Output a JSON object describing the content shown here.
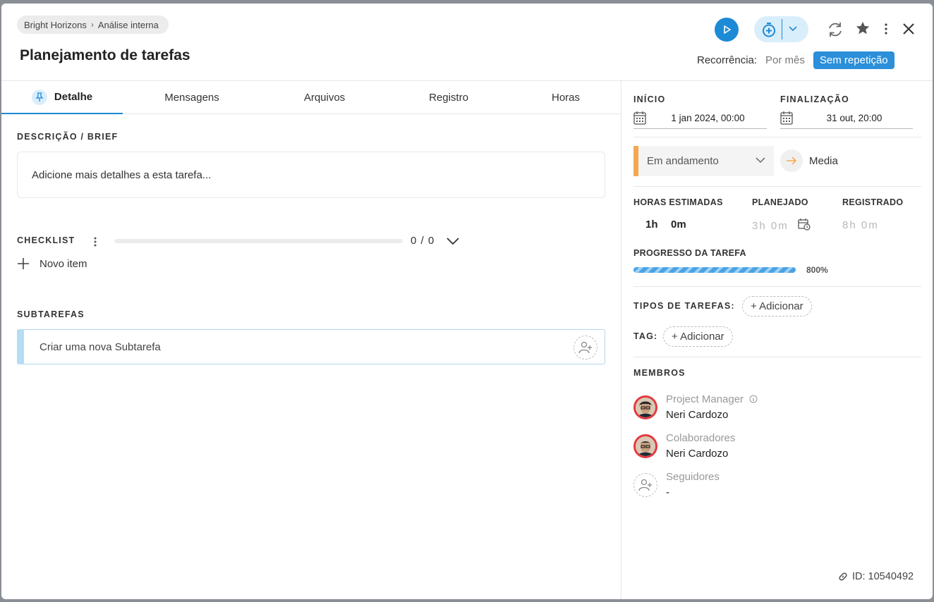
{
  "header": {
    "breadcrumb": [
      "Bright Horizons",
      "Análise interna"
    ],
    "title": "Planejamento de tarefas",
    "recurrence_label": "Recorrência:",
    "recurrence_option": "Por mês",
    "recurrence_selected": "Sem repetição"
  },
  "tabs": [
    "Detalhe",
    "Mensagens",
    "Arquivos",
    "Registro",
    "Horas"
  ],
  "description": {
    "label": "DESCRIÇÃO / BRIEF",
    "placeholder": "Adicione mais detalhes a esta tarefa..."
  },
  "checklist": {
    "label": "CHECKLIST",
    "count": "0 / 0",
    "new_item": "Novo item"
  },
  "subtasks": {
    "label": "SUBTAREFAS",
    "placeholder": "Criar uma nova Subtarefa"
  },
  "dates": {
    "start_label": "INÍCIO",
    "start_value": "1 jan 2024, 00:00",
    "end_label": "FINALIZAÇÃO",
    "end_value": "31 out, 20:00"
  },
  "status": {
    "value": "Em andamento",
    "priority": "Media",
    "status_color": "#f5a74f"
  },
  "hours": {
    "estimated_label": "HORAS ESTIMADAS",
    "estimated_h": "1h",
    "estimated_m": "0m",
    "planned_label": "PLANEJADO",
    "planned_value": "3h 0m",
    "registered_label": "REGISTRADO",
    "registered_value": "8h 0m"
  },
  "progress": {
    "label": "PROGRESSO DA TAREFA",
    "percent_text": "800%"
  },
  "task_types": {
    "label": "TIPOS DE TAREFAS:",
    "add": "+ Adicionar"
  },
  "tag": {
    "label": "TAG:",
    "add": "+ Adicionar"
  },
  "members": {
    "label": "MEMBROS",
    "pm_role": "Project Manager",
    "pm_name": "Neri Cardozo",
    "collab_role": "Colaboradores",
    "collab_name": "Neri Cardozo",
    "followers_role": "Seguidores",
    "followers_value": "-"
  },
  "footer": {
    "id_text": "ID: 10540492"
  },
  "colors": {
    "accent": "#1d8ad6",
    "selected_pill": "#2b8fd9"
  }
}
